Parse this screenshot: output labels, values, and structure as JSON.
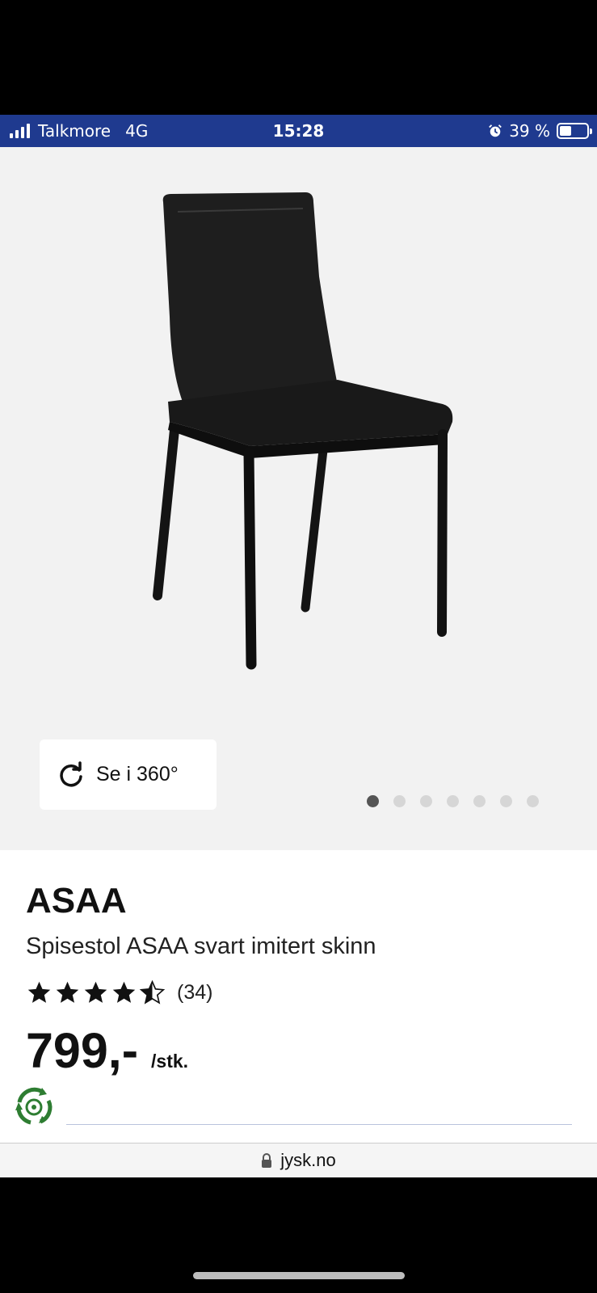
{
  "status_bar": {
    "carrier": "Talkmore",
    "network": "4G",
    "time": "15:28",
    "battery": "39 %",
    "battery_level": 0.39
  },
  "gallery": {
    "image_icon": "black-dining-chair-image",
    "view360_label": "Se i 360°",
    "image_count": 7,
    "active_index": 0
  },
  "product": {
    "brand": "ASAA",
    "name": "Spisestol ASAA svart imitert skinn",
    "rating": 4.5,
    "rating_count": "(34)",
    "price": "799,-",
    "unit": "/stk."
  },
  "browser": {
    "url": "jysk.no"
  },
  "colors": {
    "status_bar": "#1f3a8f",
    "eco_green": "#2e7d32"
  }
}
